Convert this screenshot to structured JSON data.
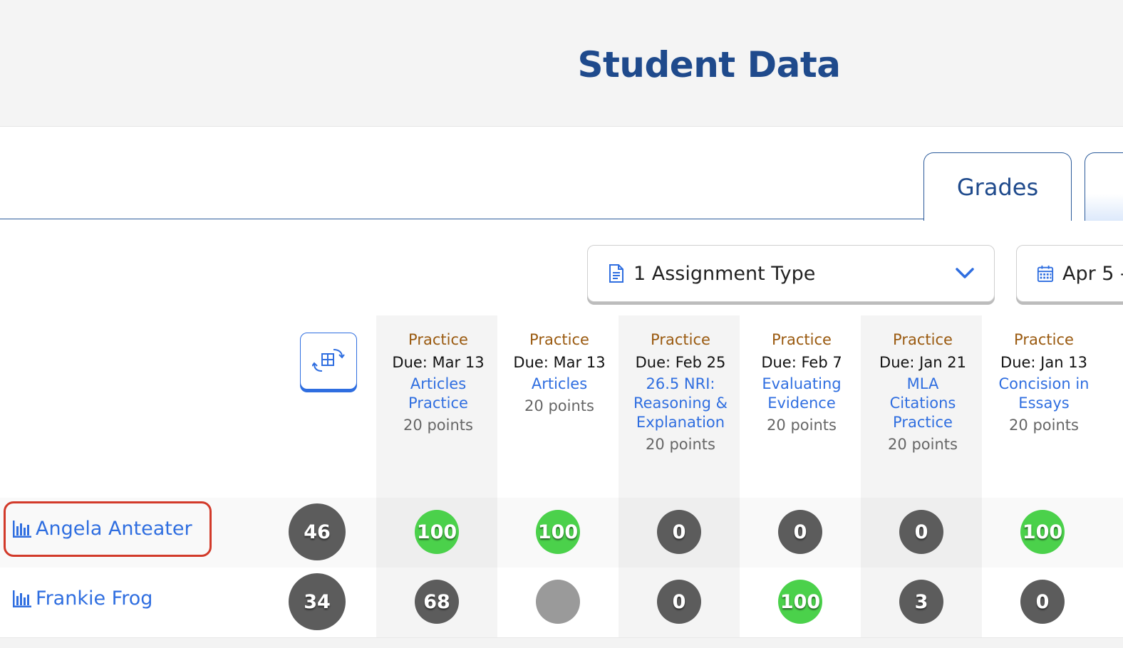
{
  "header": {
    "title": "Student Data"
  },
  "tabs": {
    "grades": "Grades"
  },
  "filters": {
    "assignment_type": "1 Assignment Type",
    "date_range": "Apr 5 -"
  },
  "columns": [
    {
      "type": "Practice",
      "due": "Due: Mar 13",
      "name_lines": [
        "Articles",
        "Practice"
      ],
      "points": "20 points"
    },
    {
      "type": "Practice",
      "due": "Due: Mar 13",
      "name_lines": [
        "Articles"
      ],
      "points": "20 points"
    },
    {
      "type": "Practice",
      "due": "Due: Feb 25",
      "name_lines": [
        "26.5 NRI:",
        "Reasoning &",
        "Explanation"
      ],
      "points": "20 points"
    },
    {
      "type": "Practice",
      "due": "Due: Feb 7",
      "name_lines": [
        "Evaluating",
        "Evidence"
      ],
      "points": "20 points"
    },
    {
      "type": "Practice",
      "due": "Due: Jan 21",
      "name_lines": [
        "MLA",
        "Citations",
        "Practice"
      ],
      "points": "20 points"
    },
    {
      "type": "Practice",
      "due": "Due: Jan 13",
      "name_lines": [
        "Concision in",
        "Essays"
      ],
      "points": "20 points"
    }
  ],
  "students": [
    {
      "name": "Angela Anteater",
      "average": "46",
      "scores": [
        "100",
        "100",
        "0",
        "0",
        "0",
        "100"
      ],
      "status": [
        "high",
        "high",
        "low",
        "low",
        "low",
        "high"
      ]
    },
    {
      "name": "Frankie Frog",
      "average": "34",
      "scores": [
        "68",
        "",
        "0",
        "100",
        "3",
        "0"
      ],
      "status": [
        "low",
        "empty",
        "low",
        "high",
        "low",
        "low"
      ]
    }
  ],
  "colors": {
    "accent": "#2f6ee0",
    "title": "#1f4a8c",
    "high_score": "#4bd14b",
    "low_score": "#5c5c5c",
    "empty_score": "#9a9a9a",
    "highlight": "#d23a2a"
  },
  "icons": {
    "assignment_type": "document-icon",
    "dropdown": "chevron-down-icon",
    "date": "calendar-icon",
    "pivot": "pivot-table-icon",
    "student": "bar-chart-icon"
  }
}
